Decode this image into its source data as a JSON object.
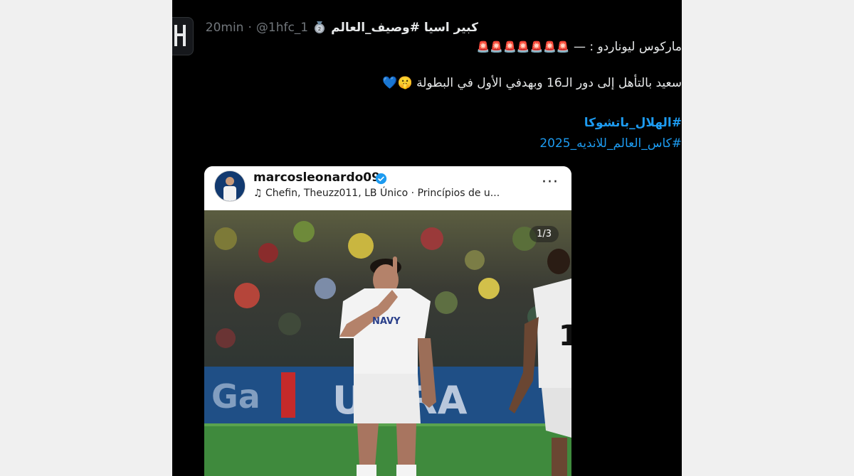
{
  "tweet": {
    "display_name": "كبير اسيا #وصيف_العالم",
    "handle": "@1hfc_1",
    "separator": "·",
    "time": "20min",
    "line1_text": "ماركوس ليوناردو :",
    "line1_dash": "—",
    "siren_glyph": "🚨",
    "line2_text": "سعيد بالتأهل إلى دور الـ16 وبهدفي الأول في البطولة",
    "line2_emoji": "🤫💙",
    "hashtag1": "#الهلال_باتشوكا",
    "hashtag2": "#كاس_العالم_للانديه_2025"
  },
  "instagram": {
    "username": "marcosleonardo09",
    "music": "Chefin, Theuzz011, LB Único · Princípios de u...",
    "more_glyph": "···",
    "counter": "1/3"
  },
  "colors": {
    "background": "#000000",
    "text": "#e7e9ea",
    "muted": "#71767b",
    "link": "#1d9bf0"
  },
  "icons": [
    "medal-icon",
    "music-note-icon",
    "verified-badge-icon",
    "more-icon"
  ]
}
